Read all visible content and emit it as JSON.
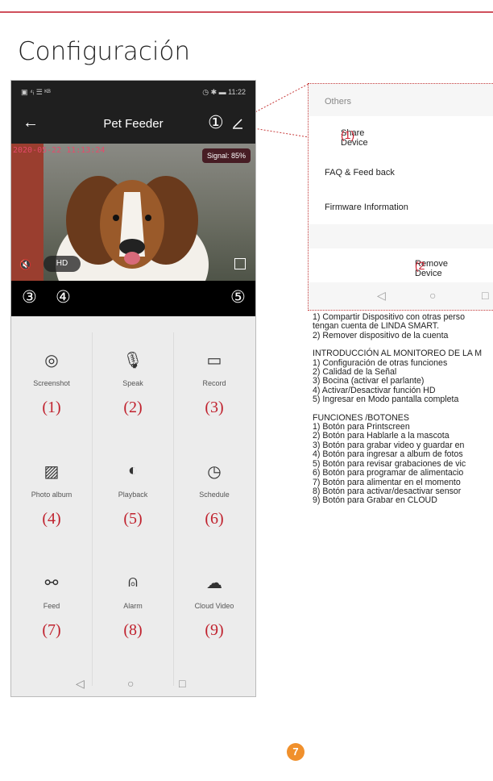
{
  "page_title": "Configuración",
  "page_number": "7",
  "phone": {
    "status_left": "▣ ⁴ᵢ ☰ ᴷᴮ",
    "status_right": "◷ ✱ ▬ 11:22",
    "app_title": "Pet Feeder",
    "callout_1": "①",
    "timestamp": "2020-05-22 11:13:24",
    "signal": "Signal: 85%",
    "hd_label": "HD",
    "callout_3": "③",
    "callout_4": "④",
    "callout_5": "⑤",
    "buttons": [
      {
        "label": "Screenshot",
        "num": "(1)",
        "icon": "camera-icon",
        "glyph": "◎"
      },
      {
        "label": "Speak",
        "num": "(2)",
        "icon": "microphone-icon",
        "glyph": "🎙"
      },
      {
        "label": "Record",
        "num": "(3)",
        "icon": "video-camera-icon",
        "glyph": "▭"
      },
      {
        "label": "Photo album",
        "num": "(4)",
        "icon": "image-icon",
        "glyph": "▨"
      },
      {
        "label": "Playback",
        "num": "(5)",
        "icon": "playback-icon",
        "glyph": "◐"
      },
      {
        "label": "Schedule",
        "num": "(6)",
        "icon": "clock-icon",
        "glyph": "◷"
      },
      {
        "label": "Feed",
        "num": "(7)",
        "icon": "bone-icon",
        "glyph": "⚯"
      },
      {
        "label": "Alarm",
        "num": "(8)",
        "icon": "alarm-icon",
        "glyph": "⍝"
      },
      {
        "label": "Cloud Video",
        "num": "(9)",
        "icon": "cloud-icon",
        "glyph": "☁"
      }
    ],
    "nav": [
      "◁",
      "○",
      "□"
    ]
  },
  "settings_panel": {
    "header": "Others",
    "share_device": "Share Device",
    "share_num": "(1)",
    "faq": "FAQ &  Feed back",
    "firmware": "Firmware  Information",
    "remove_device": "Remove Device",
    "remove_num": "(2",
    "nav": [
      "◁",
      "○",
      "□"
    ]
  },
  "notes": {
    "l1": "1) Compartir Dispositivo con otras perso",
    "l2": "tengan cuenta de LINDA SMART.",
    "l3": "2) Remover dispositivo de la cuenta",
    "intro_title": "INTRODUCCIÓN AL MONITOREO DE LA M",
    "intro": [
      "1) Configuración de otras funciones",
      "2) Calidad de la Señal",
      "3) Bocina (activar el parlante)",
      "4) Activar/Desactivar función HD",
      "5) Ingresar en Modo pantalla completa"
    ],
    "func_title": "FUNCIONES /BOTONES",
    "funcs": [
      "1) Botón para Printscreen",
      "2) Botón para Hablarle a la mascota",
      "3) Botón para grabar video y guardar en",
      "4) Botón para ingresar a album de fotos",
      "5) Botón para revisar grabaciones de vic",
      "6) Botón para programar de alimentacio",
      "7) Botón para alimentar en el momento",
      "8) Botón para activar/desactivar sensor",
      "9) Botón para Grabar en CLOUD"
    ]
  }
}
